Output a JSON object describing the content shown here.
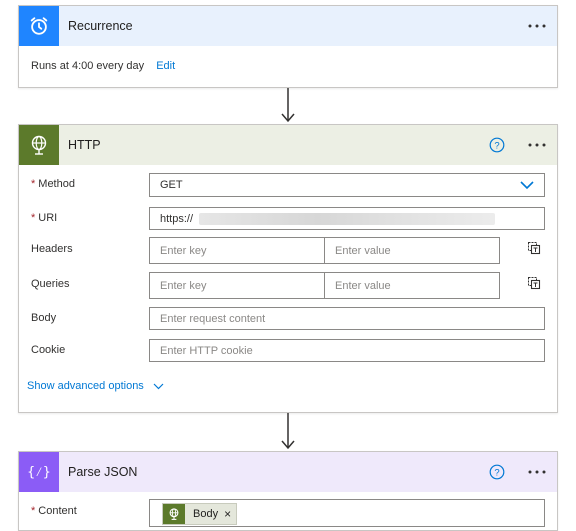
{
  "recurrence": {
    "title": "Recurrence",
    "summary": "Runs at 4:00 every day",
    "edit_label": "Edit",
    "header_color": "#e8f1fd",
    "icon_color": "#1f85ff"
  },
  "http": {
    "title": "HTTP",
    "header_color": "#ecefe4",
    "icon_color": "#5c7a2b",
    "method": {
      "label": "Method",
      "value": "GET",
      "required_mark": "*"
    },
    "uri": {
      "label": "URI",
      "value": "https://",
      "required_mark": "*"
    },
    "headers": {
      "label": "Headers",
      "key_placeholder": "Enter key",
      "value_placeholder": "Enter value"
    },
    "queries": {
      "label": "Queries",
      "key_placeholder": "Enter key",
      "value_placeholder": "Enter value"
    },
    "body": {
      "label": "Body",
      "placeholder": "Enter request content"
    },
    "cookie": {
      "label": "Cookie",
      "placeholder": "Enter HTTP cookie"
    },
    "advanced_label": "Show advanced options"
  },
  "parse_json": {
    "title": "Parse JSON",
    "header_color": "#efe9fb",
    "icon_color": "#8b5cf6",
    "icon_glyph": "{⁄}",
    "content": {
      "label": "Content",
      "required_mark": "*",
      "token_label": "Body",
      "token_remove": "×"
    }
  },
  "icons": {
    "more": "more-options-icon",
    "help": "help-icon",
    "chevron": "chevron-down-icon",
    "copy": "switch-to-text-mode-icon",
    "arrow": "arrow-down-icon"
  }
}
